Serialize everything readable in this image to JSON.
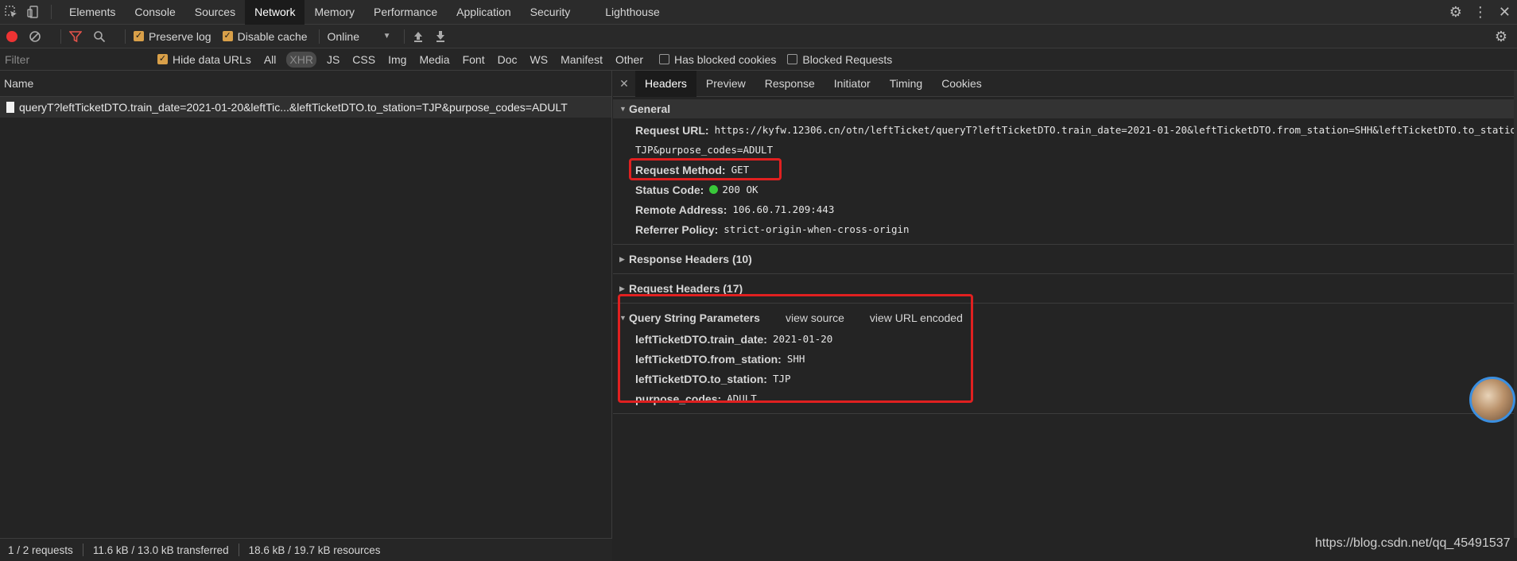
{
  "tabs": [
    "Elements",
    "Console",
    "Sources",
    "Network",
    "Memory",
    "Performance",
    "Application",
    "Security",
    "Lighthouse"
  ],
  "active_tab": "Network",
  "toolbar": {
    "preserve_log": "Preserve log",
    "disable_cache": "Disable cache",
    "throttle": "Online"
  },
  "filterbar": {
    "placeholder": "Filter",
    "hide_data_urls": "Hide data URLs",
    "types": [
      "All",
      "XHR",
      "JS",
      "CSS",
      "Img",
      "Media",
      "Font",
      "Doc",
      "WS",
      "Manifest",
      "Other"
    ],
    "selected_type": "XHR",
    "has_blocked_cookies": "Has blocked cookies",
    "blocked_requests": "Blocked Requests"
  },
  "list": {
    "header": "Name",
    "rows": [
      "queryT?leftTicketDTO.train_date=2021-01-20&leftTic...&leftTicketDTO.to_station=TJP&purpose_codes=ADULT"
    ]
  },
  "status": {
    "requests": "1 / 2 requests",
    "transferred": "11.6 kB / 13.0 kB transferred",
    "resources": "18.6 kB / 19.7 kB resources"
  },
  "detail_tabs": [
    "Headers",
    "Preview",
    "Response",
    "Initiator",
    "Timing",
    "Cookies"
  ],
  "general": {
    "title": "General",
    "request_url_label": "Request URL:",
    "request_url": "https://kyfw.12306.cn/otn/leftTicket/queryT?leftTicketDTO.train_date=2021-01-20&leftTicketDTO.from_station=SHH&leftTicketDTO.to_station=",
    "request_url_cont": "TJP&purpose_codes=ADULT",
    "method_label": "Request Method:",
    "method": "GET",
    "status_label": "Status Code:",
    "status": "200 OK",
    "remote_label": "Remote Address:",
    "remote": "106.60.71.209:443",
    "referrer_label": "Referrer Policy:",
    "referrer": "strict-origin-when-cross-origin"
  },
  "response_headers": "Response Headers (10)",
  "request_headers": "Request Headers (17)",
  "query": {
    "title": "Query String Parameters",
    "view_source": "view source",
    "view_url_encoded": "view URL encoded",
    "params": [
      {
        "key": "leftTicketDTO.train_date:",
        "value": "2021-01-20"
      },
      {
        "key": "leftTicketDTO.from_station:",
        "value": "SHH"
      },
      {
        "key": "leftTicketDTO.to_station:",
        "value": "TJP"
      },
      {
        "key": "purpose_codes:",
        "value": "ADULT"
      }
    ]
  },
  "watermark": "https://blog.csdn.net/qq_45491537",
  "colors": {
    "highlight": "#e02020",
    "status_ok": "#39c83a",
    "checkbox": "#d9a049",
    "record": "#e33"
  }
}
